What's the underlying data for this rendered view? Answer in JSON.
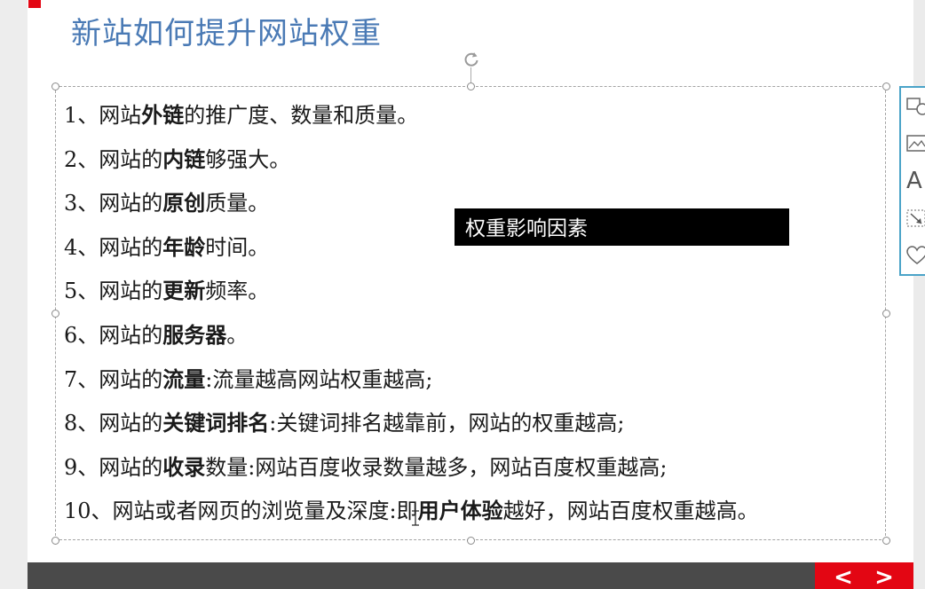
{
  "slide": {
    "title": "新站如何提升网站权重",
    "items": [
      {
        "seg": [
          {
            "t": "1、网站"
          },
          {
            "t": "外链",
            "b": true
          },
          {
            "t": "的推广度、数量和质量。"
          }
        ]
      },
      {
        "seg": [
          {
            "t": "2、网站的"
          },
          {
            "t": "内链",
            "b": true
          },
          {
            "t": "够强大。"
          }
        ]
      },
      {
        "seg": [
          {
            "t": "3、网站的"
          },
          {
            "t": "原创",
            "b": true
          },
          {
            "t": "质量。"
          }
        ]
      },
      {
        "seg": [
          {
            "t": "4、网站的"
          },
          {
            "t": "年龄",
            "b": true
          },
          {
            "t": "时间。"
          }
        ]
      },
      {
        "seg": [
          {
            "t": "5、网站的"
          },
          {
            "t": "更新",
            "b": true
          },
          {
            "t": "频率。"
          }
        ]
      },
      {
        "seg": [
          {
            "t": "6、网站的"
          },
          {
            "t": "服务器",
            "b": true
          },
          {
            "t": "。"
          }
        ]
      },
      {
        "seg": [
          {
            "t": "7、网站的"
          },
          {
            "t": "流量",
            "b": true
          },
          {
            "t": ":流量越高网站权重越高;"
          }
        ]
      },
      {
        "seg": [
          {
            "t": "8、网站的"
          },
          {
            "t": "关键词排名",
            "b": true
          },
          {
            "t": ":关键词排名越靠前，网站的权重越高;"
          }
        ]
      },
      {
        "seg": [
          {
            "t": "9、网站的"
          },
          {
            "t": "收录",
            "b": true
          },
          {
            "t": "数量:网站百度收录数量越多，网站百度权重越高;"
          }
        ]
      },
      {
        "seg": [
          {
            "t": "10、网站或者网页的浏览量及深度:即"
          },
          {
            "t": "用户体验",
            "b": true
          },
          {
            "t": "越好，网站百度权重越高。"
          }
        ]
      }
    ]
  },
  "tooltip": {
    "text": "权重影响因素"
  },
  "quick_toolbar": {
    "buttons": [
      {
        "icon": "shapes-icon"
      },
      {
        "icon": "picture-icon"
      },
      {
        "icon": "text-icon",
        "label": "A"
      },
      {
        "icon": "resize-icon"
      },
      {
        "icon": "heart-icon"
      }
    ]
  },
  "nav": {
    "prev_label": "<",
    "next_label": ">"
  },
  "colors": {
    "title": "#4a7ab5",
    "accent_red": "#e30613",
    "toolbar_border": "#4aa3c8",
    "bottom_bar": "#4a4a4a"
  }
}
